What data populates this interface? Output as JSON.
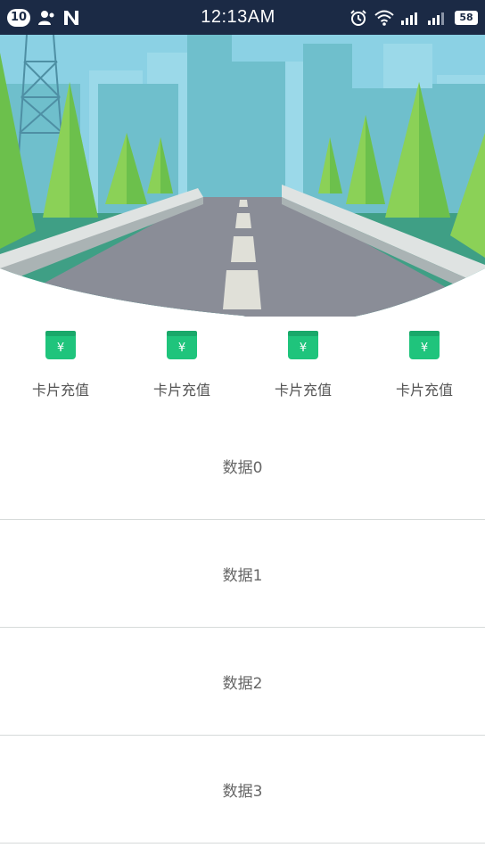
{
  "status_bar": {
    "notification_count": "10",
    "time": "12:13AM",
    "battery": "58",
    "left_icons": [
      "person-icon",
      "n-app-icon"
    ],
    "right_icons": [
      "alarm-icon",
      "wifi-icon",
      "signal-icon",
      "signal-icon"
    ],
    "background": "#1b2a45"
  },
  "banner": {
    "image": "road-city-illustration"
  },
  "quick_actions": [
    {
      "label": "卡片充值",
      "icon": "card-recharge-icon"
    },
    {
      "label": "卡片充值",
      "icon": "card-recharge-icon"
    },
    {
      "label": "卡片充值",
      "icon": "card-recharge-icon"
    },
    {
      "label": "卡片充值",
      "icon": "card-recharge-icon"
    }
  ],
  "icon_color": "#1fc47c",
  "list": [
    {
      "label": "数据0"
    },
    {
      "label": "数据1"
    },
    {
      "label": "数据2"
    },
    {
      "label": "数据3"
    }
  ]
}
